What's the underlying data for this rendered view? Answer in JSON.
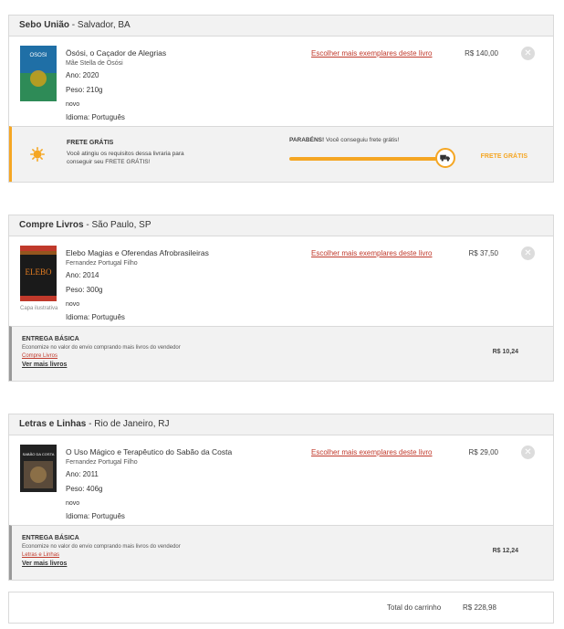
{
  "sellers": [
    {
      "name": "Sebo União",
      "location": " - Salvador, BA",
      "book": {
        "title": "Ösósi, o Caçador de Alegrias",
        "author": "Mãe Stella de Ösósi",
        "year": "Ano: 2020",
        "weight": "Peso: 210g",
        "condition": "novo",
        "language": "Idioma: Português",
        "cover_text": "OSOSI"
      },
      "choose_link": "Escolher mais exemplares deste livro",
      "price": "R$ 140,00",
      "shipping": {
        "type": "free",
        "title": "FRETE GRÁTIS",
        "desc": "Você atingiu os requisitos dessa livraria para conseguir seu FRETE GRÁTIS!",
        "congrats_bold": "PARABÉNS!",
        "congrats": " Você conseguiu frete grátis!",
        "progress": 1.0,
        "label": "FRETE GRÁTIS"
      }
    },
    {
      "name": "Compre Livros",
      "location": " - São Paulo, SP",
      "book": {
        "title": "Elebo Magias e Oferendas Afrobrasileiras",
        "author": "Fernandez Portugal Filho",
        "year": "Ano: 2014",
        "weight": "Peso: 300g",
        "condition": "novo",
        "language": "Idioma: Português",
        "cover_text": "ELEBO",
        "cover_caption": "Capa ilustrativa"
      },
      "choose_link": "Escolher mais exemplares deste livro",
      "price": "R$ 37,50",
      "shipping": {
        "type": "basic",
        "title": "ENTREGA BÁSICA",
        "desc": "Economize no valor do envio comprando mais livros do vendedor",
        "seller_link": "Compre Livros",
        "more": "Ver mais livros",
        "price": "R$ 10,24"
      }
    },
    {
      "name": "Letras e Linhas",
      "location": " - Rio de Janeiro, RJ",
      "book": {
        "title": "O Uso Mágico e Terapêutico do Sabão da Costa",
        "author": "Fernandez Portugal Filho",
        "year": "Ano: 2011",
        "weight": "Peso: 406g",
        "condition": "novo",
        "language": "Idioma: Português",
        "cover_text": "SABÃO DA COSTA"
      },
      "choose_link": "Escolher mais exemplares deste livro",
      "price": "R$ 29,00",
      "shipping": {
        "type": "basic",
        "title": "ENTREGA BÁSICA",
        "desc": "Economize no valor do envio comprando mais livros do vendedor",
        "seller_link": "Letras e Linhas",
        "more": "Ver mais livros",
        "price": "R$ 12,24"
      }
    }
  ],
  "total": {
    "label": "Total do carrinho",
    "value": "R$ 228,98"
  },
  "colors": {
    "accent": "#f5a623",
    "link": "#c0392b",
    "panel": "#f2f2f2"
  }
}
